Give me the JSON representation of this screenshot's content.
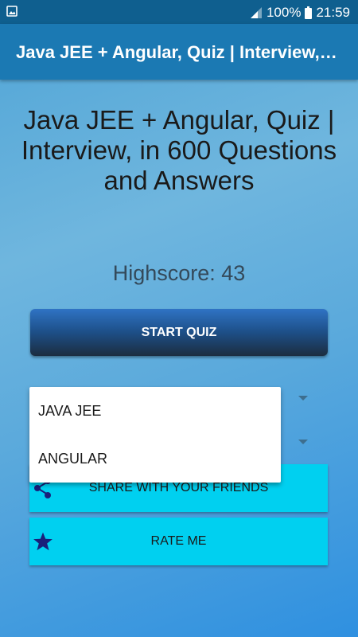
{
  "status_bar": {
    "battery": "100%",
    "time": "21:59"
  },
  "app_bar": {
    "title": "Java JEE + Angular, Quiz | Interview, in 600 Questions and Answers"
  },
  "main": {
    "title": "Java JEE + Angular, Quiz | Interview, in 600 Questions and Answers",
    "highscore": "Highscore: 43",
    "start_button": "START QUIZ",
    "dropdown_options": [
      "JAVA JEE",
      "ANGULAR"
    ],
    "share_button": "SHARE WITH YOUR FRIENDS",
    "rate_button": "RATE ME"
  },
  "icons": {
    "image": "image-icon",
    "signal": "signal-icon",
    "battery": "battery-icon",
    "share": "share-icon",
    "star": "star-icon"
  },
  "colors": {
    "app_bar": "#1b79b3",
    "status_bar": "#0f5f8f",
    "cyan_button": "#00d0f0",
    "icon_navy": "#1a1f7a"
  }
}
